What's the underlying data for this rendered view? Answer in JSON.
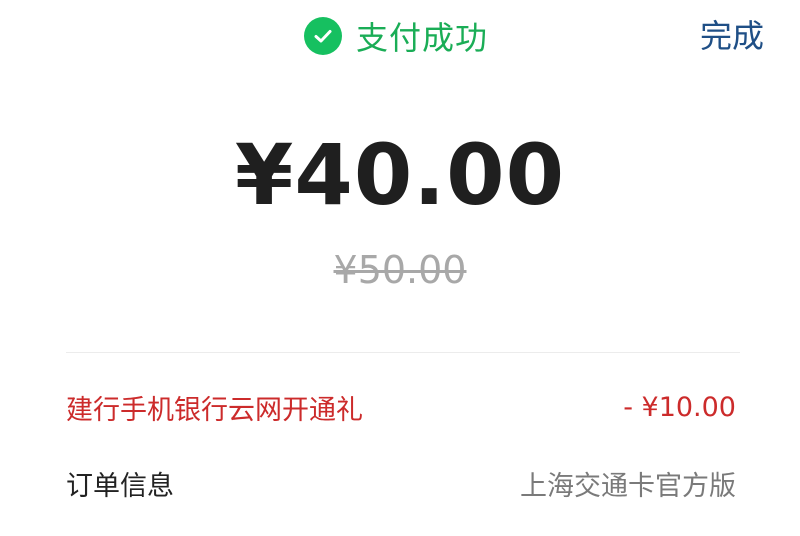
{
  "header": {
    "status_text": "支付成功",
    "done_label": "完成",
    "icon": "check-circle-icon",
    "status_color": "#1aad56",
    "done_color": "#1f4f86"
  },
  "payment": {
    "amount": "¥40.00",
    "original_amount": "¥50.00"
  },
  "details": {
    "promo_label": "建行手机银行云网开通礼",
    "promo_value": "- ¥10.00",
    "promo_color": "#cc2b2b",
    "order_label": "订单信息",
    "order_value": "上海交通卡官方版"
  }
}
